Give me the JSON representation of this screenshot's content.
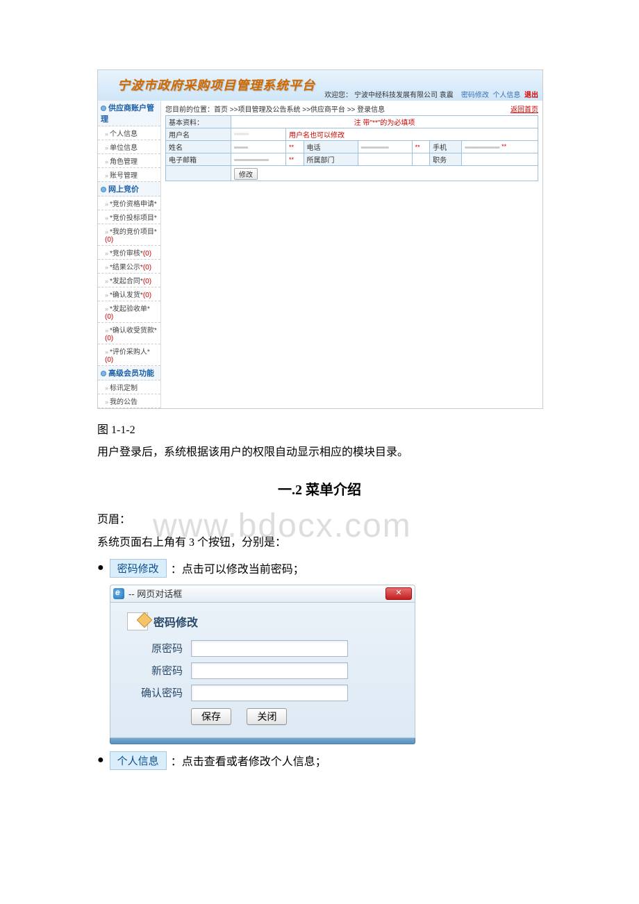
{
  "screenshot": {
    "system_title": "宁波市政府采购项目管理系统平台",
    "welcome_prefix": "欢迎您：",
    "welcome_user": "宁波中经科技发展有限公司 袁震",
    "link_pw": "密码修改",
    "link_info": "个人信息",
    "link_exit": "退出",
    "return_home": "返回首页",
    "breadcrumb": "您目前的位置：首页 >>项目管理及公告系统 >>供应商平台 >> 登录信息",
    "section_basic": "基本资料：",
    "required_note": "注 带\"**\"的为必填项",
    "labels": {
      "username": "用户名",
      "username_note": "用户名也可以修改",
      "name": "姓名",
      "phone": "电话",
      "mobile": "手机",
      "email": "电子邮箱",
      "dept": "所属部门",
      "post": "职务"
    },
    "modify_btn": "修改",
    "sidebar": {
      "g1": "供应商账户管理",
      "g1_items": [
        "个人信息",
        "单位信息",
        "角色管理",
        "账号管理"
      ],
      "g2": "网上竞价",
      "g2_items": [
        {
          "t": "*竞价资格申请*",
          "c": ""
        },
        {
          "t": "*竞价投标项目*",
          "c": ""
        },
        {
          "t": "*我的竞价项目*",
          "c": "(0)"
        },
        {
          "t": "*竞价审核*",
          "c": "(0)"
        },
        {
          "t": "*结果公示*",
          "c": "(0)"
        },
        {
          "t": "*发起合同*",
          "c": "(0)"
        },
        {
          "t": "*确认发货*",
          "c": "(0)"
        },
        {
          "t": "*发起验收单*",
          "c": "(0)"
        },
        {
          "t": "*确认收受货款*",
          "c": "(0)"
        },
        {
          "t": "*评价采购人*",
          "c": "(0)"
        }
      ],
      "g3": "高级会员功能",
      "g3_items": [
        "标讯定制",
        "我的公告"
      ]
    }
  },
  "doc": {
    "fig_caption": "图 1-1-2",
    "p1": "用户登录后，系统根据该用户的权限自动显示相应的模块目录。",
    "h2": "一.2 菜单介绍",
    "p2a": "页眉：",
    "p2b": "系统页面右上角有 3 个按钮，分别是：",
    "watermark": "www.bdocx.com",
    "bullet1_tag": "密码修改",
    "bullet1_txt": "：点击可以修改当前密码；",
    "bullet2_tag": "个人信息",
    "bullet2_txt": "：点击查看或者修改个人信息；"
  },
  "dialog": {
    "title": " -- 网页对话框",
    "close": "✕",
    "heading": "密码修改",
    "old_pw": "原密码",
    "new_pw": "新密码",
    "confirm_pw": "确认密码",
    "save": "保存",
    "close_btn": "关闭"
  }
}
